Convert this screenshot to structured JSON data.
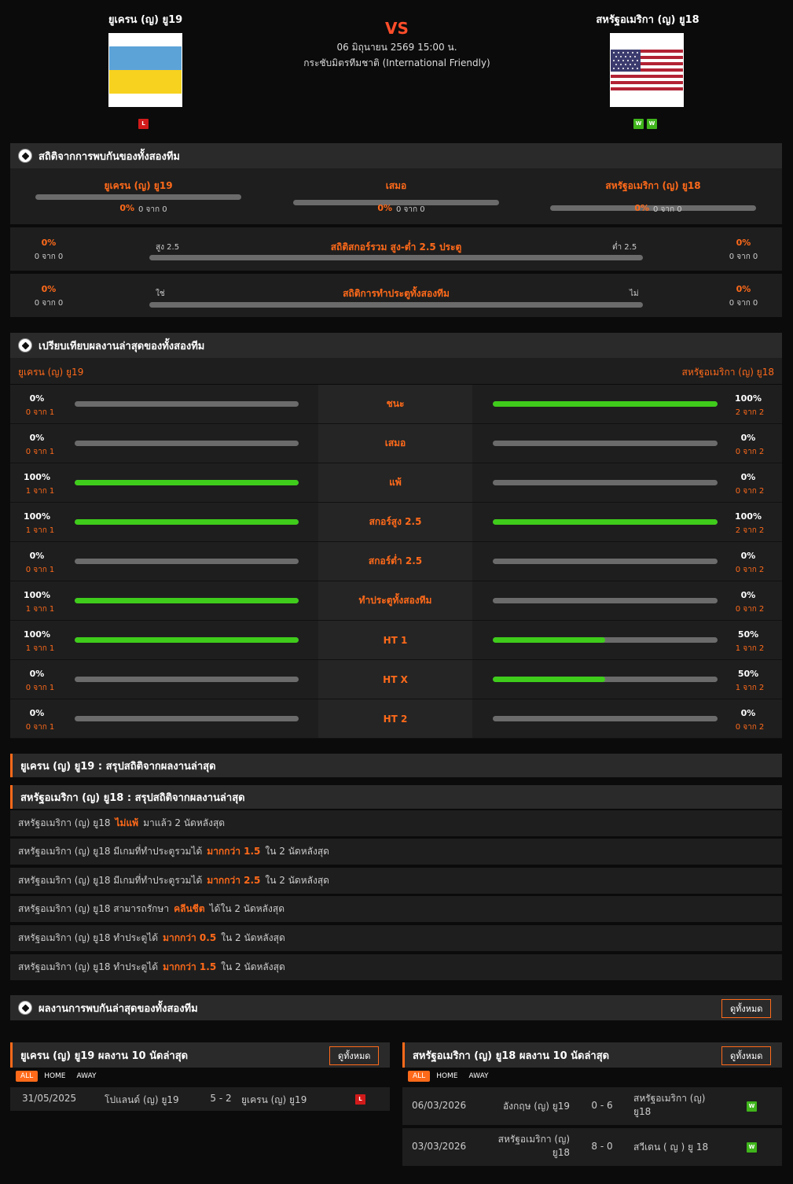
{
  "header": {
    "home_name": "ยูเครน (ญ) ยู19",
    "away_name": "สหรัฐอเมริกา (ญ) ยู18",
    "vs": "VS",
    "datetime": "06 มิถุนายน 2569 15:00 น.",
    "competition": "กระชับมิตรทีมชาติ (International Friendly)",
    "home_form": [
      "L"
    ],
    "away_form": [
      "W",
      "W"
    ]
  },
  "h2h": {
    "title": "สถิติจากการพบกันของทั้งสองทีม",
    "cols": [
      {
        "label": "ยูเครน (ญ) ยู19",
        "pct": "0%",
        "sub": "0 จาก 0"
      },
      {
        "label": "เสมอ",
        "pct": "0%",
        "sub": "0 จาก 0"
      },
      {
        "label": "สหรัฐอเมริกา (ญ) ยู18",
        "pct": "0%",
        "sub": "0 จาก 0"
      }
    ],
    "ou": {
      "title": "สถิติสกอร์รวม สูง-ต่ำ 2.5 ประตู",
      "left_label": "สูง 2.5",
      "right_label": "ต่ำ 2.5",
      "left_pct": "0%",
      "left_sub": "0 จาก 0",
      "right_pct": "0%",
      "right_sub": "0 จาก 0"
    },
    "btts": {
      "title": "สถิติการทำประตูทั้งสองทีม",
      "left_label": "ใช่",
      "right_label": "ไม่",
      "left_pct": "0%",
      "left_sub": "0 จาก 0",
      "right_pct": "0%",
      "right_sub": "0 จาก 0"
    }
  },
  "compare": {
    "title": "เปรียบเทียบผลงานล่าสุดของทั้งสองทีม",
    "home_name": "ยูเครน (ญ) ยู19",
    "away_name": "สหรัฐอเมริกา (ญ) ยู18",
    "rows": [
      {
        "label": "ชนะ",
        "home_pct": "0%",
        "home_sub": "0 จาก 1",
        "home_fill": 0,
        "away_pct": "100%",
        "away_sub": "2 จาก 2",
        "away_fill": 1
      },
      {
        "label": "เสมอ",
        "home_pct": "0%",
        "home_sub": "0 จาก 1",
        "home_fill": 0,
        "away_pct": "0%",
        "away_sub": "0 จาก 2",
        "away_fill": 0
      },
      {
        "label": "แพ้",
        "home_pct": "100%",
        "home_sub": "1 จาก 1",
        "home_fill": 1,
        "away_pct": "0%",
        "away_sub": "0 จาก 2",
        "away_fill": 0
      },
      {
        "label": "สกอร์สูง 2.5",
        "home_pct": "100%",
        "home_sub": "1 จาก 1",
        "home_fill": 1,
        "away_pct": "100%",
        "away_sub": "2 จาก 2",
        "away_fill": 1
      },
      {
        "label": "สกอร์ต่ำ 2.5",
        "home_pct": "0%",
        "home_sub": "0 จาก 1",
        "home_fill": 0,
        "away_pct": "0%",
        "away_sub": "0 จาก 2",
        "away_fill": 0
      },
      {
        "label": "ทำประตูทั้งสองทีม",
        "home_pct": "100%",
        "home_sub": "1 จาก 1",
        "home_fill": 1,
        "away_pct": "0%",
        "away_sub": "0 จาก 2",
        "away_fill": 0
      },
      {
        "label": "HT 1",
        "home_pct": "100%",
        "home_sub": "1 จาก 1",
        "home_fill": 1,
        "away_pct": "50%",
        "away_sub": "1 จาก 2",
        "away_fill": 0.5
      },
      {
        "label": "HT X",
        "home_pct": "0%",
        "home_sub": "0 จาก 1",
        "home_fill": 0,
        "away_pct": "50%",
        "away_sub": "1 จาก 2",
        "away_fill": 0.5
      },
      {
        "label": "HT 2",
        "home_pct": "0%",
        "home_sub": "0 จาก 1",
        "home_fill": 0,
        "away_pct": "0%",
        "away_sub": "0 จาก 2",
        "away_fill": 0
      }
    ]
  },
  "summary": {
    "home_title": "ยูเครน (ญ) ยู19 : สรุปสถิติจากผลงานล่าสุด",
    "away_title": "สหรัฐอเมริกา (ญ) ยู18 : สรุปสถิติจากผลงานล่าสุด",
    "rows": [
      {
        "pre": "สหรัฐอเมริกา (ญ) ยู18",
        "hl": "ไม่แพ้",
        "post": "มาแล้ว 2 นัดหลังสุด"
      },
      {
        "pre": "สหรัฐอเมริกา (ญ) ยู18 มีเกมที่ทำประตูรวมได้",
        "hl": "มากกว่า 1.5",
        "post": "ใน 2 นัดหลังสุด"
      },
      {
        "pre": "สหรัฐอเมริกา (ญ) ยู18 มีเกมที่ทำประตูรวมได้",
        "hl": "มากกว่า 2.5",
        "post": "ใน 2 นัดหลังสุด"
      },
      {
        "pre": "สหรัฐอเมริกา (ญ) ยู18 สามารถรักษา",
        "hl": "คลีนชีต",
        "post": "ได้ใน 2 นัดหลังสุด"
      },
      {
        "pre": "สหรัฐอเมริกา (ญ) ยู18 ทำประตูได้",
        "hl": "มากกว่า 0.5",
        "post": "ใน 2 นัดหลังสุด"
      },
      {
        "pre": "สหรัฐอเมริกา (ญ) ยู18 ทำประตูได้",
        "hl": "มากกว่า 1.5",
        "post": "ใน 2 นัดหลังสุด"
      }
    ]
  },
  "recent_h2h": {
    "title": "ผลงานการพบกันล่าสุดของทั้งสองทีม",
    "view_all": "ดูทั้งหมด"
  },
  "home_last10": {
    "title": "ยูเครน (ญ) ยู19 ผลงาน 10 นัดล่าสุด",
    "view_all": "ดูทั้งหมด",
    "tabs": [
      "ALL",
      "HOME",
      "AWAY"
    ],
    "matches": [
      {
        "date": "31/05/2025",
        "home": "โปแลนด์ (ญ) ยู19",
        "score": "5 - 2",
        "away": "ยูเครน (ญ) ยู19",
        "result": "L"
      }
    ]
  },
  "away_last10": {
    "title": "สหรัฐอเมริกา (ญ) ยู18 ผลงาน 10 นัดล่าสุด",
    "view_all": "ดูทั้งหมด",
    "tabs": [
      "ALL",
      "HOME",
      "AWAY"
    ],
    "matches": [
      {
        "date": "06/03/2026",
        "home": "อังกฤษ (ญ) ยู19",
        "score": "0 - 6",
        "away": "สหรัฐอเมริกา (ญ) ยู18",
        "result": "W"
      },
      {
        "date": "03/03/2026",
        "home": "สหรัฐอเมริกา (ญ) ยู18",
        "score": "8 - 0",
        "away": "สวีเดน ( ญ ) ยู 18",
        "result": "W"
      }
    ]
  },
  "colors": {
    "accent": "#ff6a1a",
    "win": "#3fb51b",
    "loss": "#d21a1a",
    "bar_fill": "#3fcc1b"
  }
}
